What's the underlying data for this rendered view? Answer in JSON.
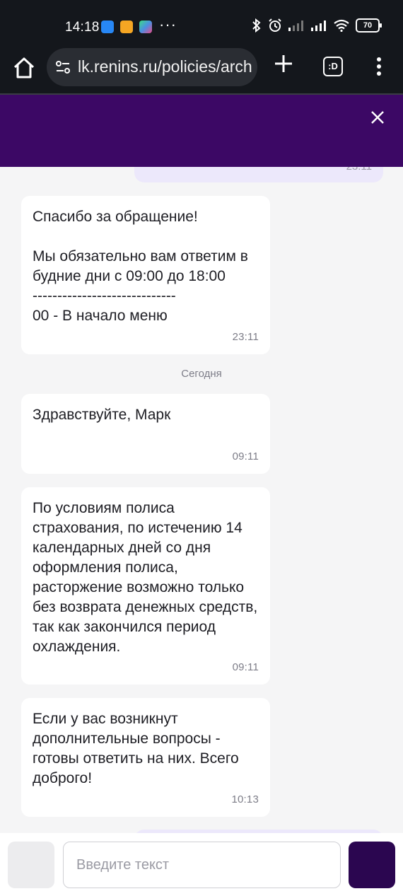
{
  "status_bar": {
    "time": "14:18",
    "battery": "70",
    "app_icons": [
      "vk-icon",
      "notes-icon",
      "app-icon"
    ],
    "more": "···"
  },
  "browser": {
    "url": "lk.renins.ru/policies/arch",
    "tabs_label": ":D"
  },
  "chat": {
    "header_color": "#3c0865",
    "top_outgoing_time": "23:11",
    "messages": [
      {
        "text": "Спасибо за обращение!\n\nМы обязательно вам ответим в будние дни с 09:00 до 18:00\n-----------------------------\n00 - В начало меню",
        "time": "23:11"
      },
      {
        "text": "Здравствуйте, Марк",
        "time": "09:11"
      },
      {
        "text": "По условиям полиса страхования, по истечению 14 календарных дней со дня оформления полиса, расторжение возможно только без возврата денежных средств, так как закончился период охлаждения.",
        "time": "09:11"
      },
      {
        "text": "Если у вас возникнут дополнительные вопросы - готовы ответить на них. Всего доброго!",
        "time": "10:13"
      }
    ],
    "day_separator": "Сегодня"
  },
  "input": {
    "placeholder": "Введите текст",
    "send_color": "#2b0650"
  }
}
